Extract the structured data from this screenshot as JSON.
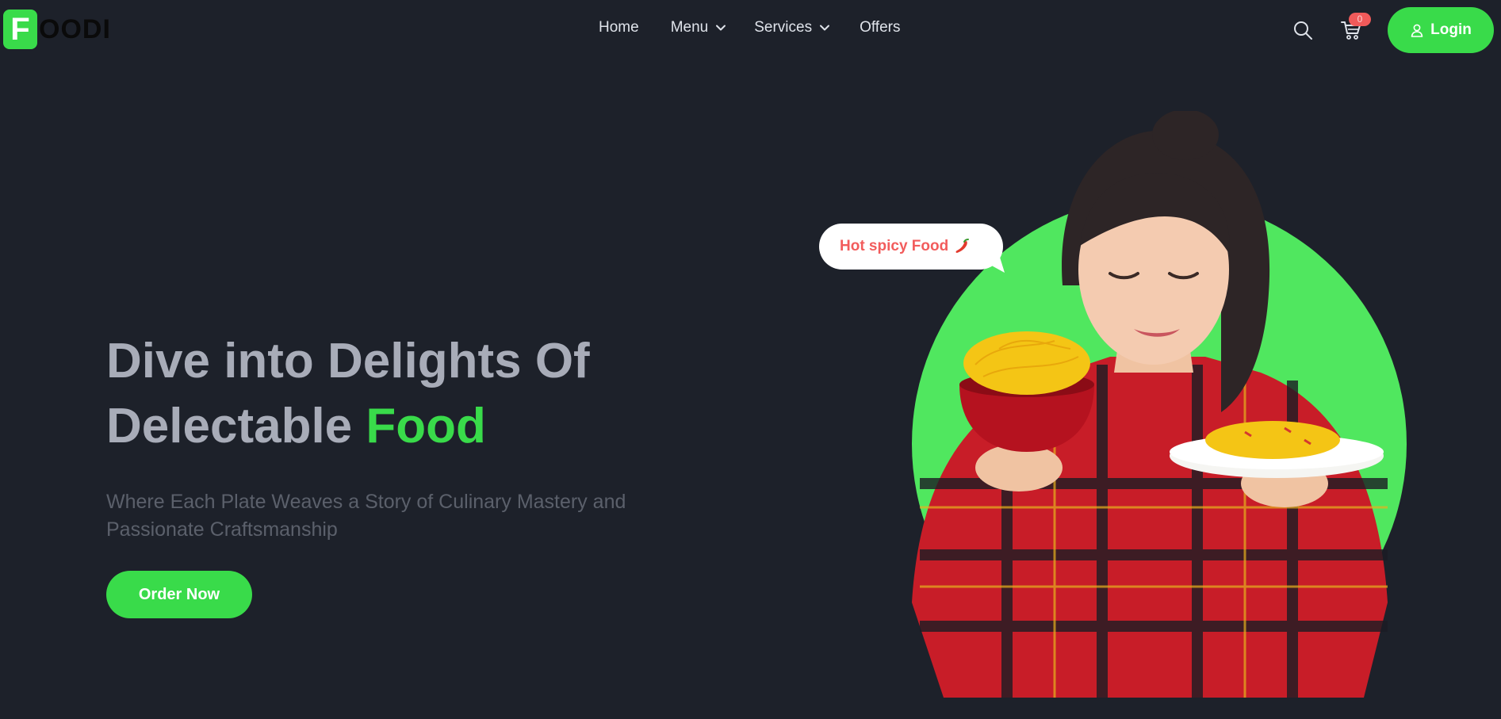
{
  "brand": {
    "badge": "F",
    "name": "OODI",
    "accent_color": "#39db4a"
  },
  "nav": {
    "items": [
      {
        "label": "Home"
      },
      {
        "label": "Menu"
      },
      {
        "label": "Services"
      },
      {
        "label": "Offers"
      }
    ],
    "cart_count": "0",
    "login_label": "Login"
  },
  "hero": {
    "headline_line1": "Dive into Delights Of",
    "headline_line2_prefix": "Delectable",
    "headline_accent": "Food",
    "subtext": "Where Each Plate Weaves a Story of Culinary Mastery and Passionate Craftsmanship",
    "cta_label": "Order Now",
    "speech_bubble": "Hot spicy Food"
  },
  "icons": {
    "search": "search-icon",
    "cart": "cart-icon",
    "user": "user-icon",
    "chevron": "chevron-down-icon",
    "pepper": "chili-pepper-icon"
  }
}
